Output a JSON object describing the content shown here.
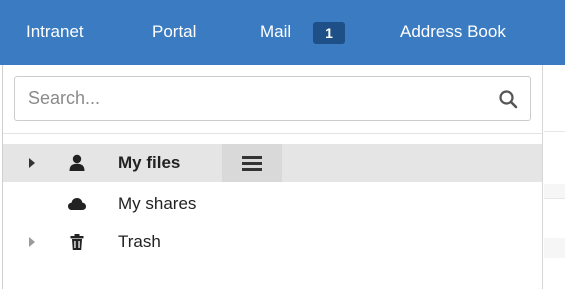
{
  "navbar": {
    "items": [
      "Intranet",
      "Portal",
      "Mail",
      "Address Book"
    ],
    "mail_badge": "1",
    "background_color": "#3a7bc1",
    "badge_color": "#1e4f86"
  },
  "search": {
    "placeholder": "Search...",
    "icon": "search-icon"
  },
  "tree": {
    "items": [
      {
        "label": "My files",
        "icon": "user-icon",
        "expandable": true,
        "selected": true
      },
      {
        "label": "My shares",
        "icon": "cloud-icon",
        "expandable": false,
        "selected": false
      },
      {
        "label": "Trash",
        "icon": "trash-icon",
        "expandable": true,
        "selected": false
      }
    ],
    "menu_icon": "hamburger-menu-icon",
    "selected_color": "#e5e5e5"
  }
}
